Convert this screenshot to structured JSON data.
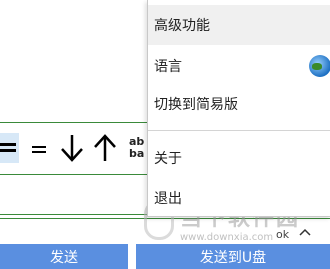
{
  "menu": {
    "items": [
      {
        "label": "高级功能"
      },
      {
        "label": "语言"
      },
      {
        "label": "切换到简易版"
      },
      {
        "label": "关于"
      },
      {
        "label": "退出"
      }
    ]
  },
  "toolbar": {
    "extra_label_top": "ab",
    "extra_label_bottom": "ba"
  },
  "bottom": {
    "send_label": "发送",
    "send_usb_label": "发送到U盘"
  },
  "status": {
    "left_text": "ok",
    "right_icon": "caret-up-icon"
  },
  "watermark": {
    "title": "当下软件园",
    "url": "www.downxia.com"
  },
  "colors": {
    "accent": "#5a8fe0",
    "divider": "#3a8a3a"
  }
}
